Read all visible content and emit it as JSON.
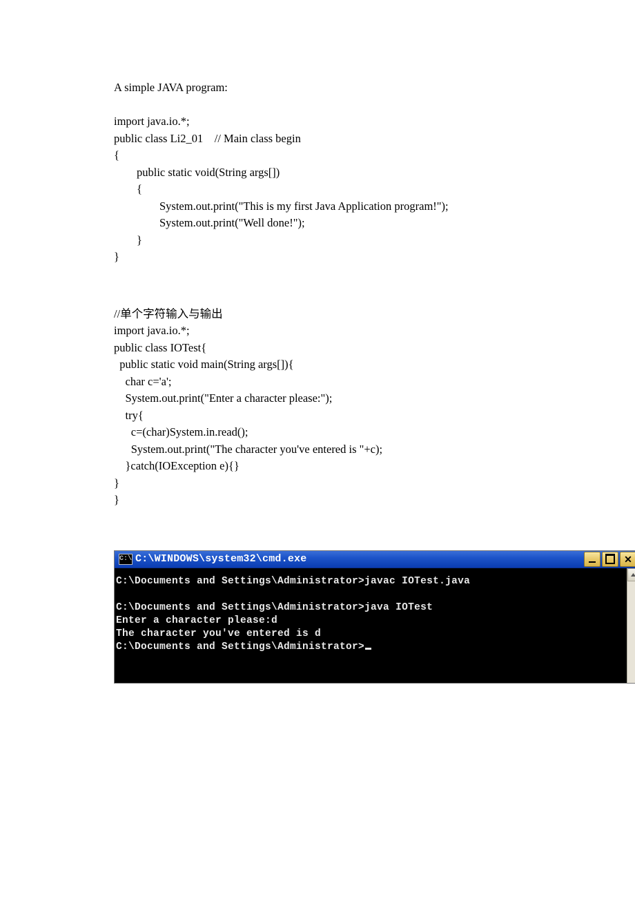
{
  "code1": {
    "l1": "A simple JAVA program:",
    "l2": "",
    "l3": "import java.io.*;",
    "l4": "public class Li2_01    // Main class begin",
    "l5": "{",
    "l6": "        public static void(String args[])",
    "l7": "        {",
    "l8": "                System.out.print(\"This is my first Java Application program!\");",
    "l9": "                System.out.print(\"Well done!\");",
    "l10": "        }",
    "l11": "}"
  },
  "code2": {
    "l1": "//单个字符输入与输出",
    "l2": "import java.io.*;",
    "l3": "public class IOTest{",
    "l4": "  public static void main(String args[]){",
    "l5": "    char c='a';",
    "l6": "    System.out.print(\"Enter a character please:\");",
    "l7": "    try{",
    "l8": "      c=(char)System.in.read();",
    "l9": "      System.out.print(\"The character you've entered is \"+c);",
    "l10": "    }catch(IOException e){}",
    "l11": "}",
    "l12": "}"
  },
  "cmd": {
    "icon_text": "C:\\",
    "title": "C:\\WINDOWS\\system32\\cmd.exe",
    "line1": "C:\\Documents and Settings\\Administrator>javac IOTest.java",
    "line2": "",
    "line3": "C:\\Documents and Settings\\Administrator>java IOTest",
    "line4": "Enter a character please:d",
    "line5": "The character you've entered is d",
    "line6_a": "C:\\Documents and Settings\\Administrator>"
  }
}
